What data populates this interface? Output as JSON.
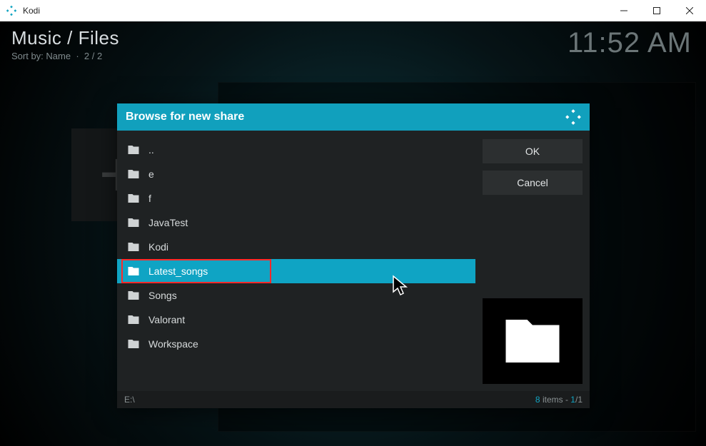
{
  "titlebar": {
    "app_name": "Kodi"
  },
  "breadcrumb": {
    "main": "Music / Files",
    "sort_label": "Sort by: Name",
    "count": "2 / 2"
  },
  "clock": "11:52 AM",
  "dialog": {
    "title": "Browse for new share",
    "ok_label": "OK",
    "cancel_label": "Cancel",
    "footer_path": "E:\\",
    "footer_count": "8",
    "footer_items_word": " items - ",
    "footer_page_cur": "1",
    "footer_page_sep": "/",
    "footer_page_total": "1",
    "items": [
      {
        "label": ".."
      },
      {
        "label": "e"
      },
      {
        "label": "f"
      },
      {
        "label": "JavaTest"
      },
      {
        "label": "Kodi"
      },
      {
        "label": "Latest_songs"
      },
      {
        "label": "Songs"
      },
      {
        "label": "Valorant"
      },
      {
        "label": "Workspace"
      }
    ]
  }
}
